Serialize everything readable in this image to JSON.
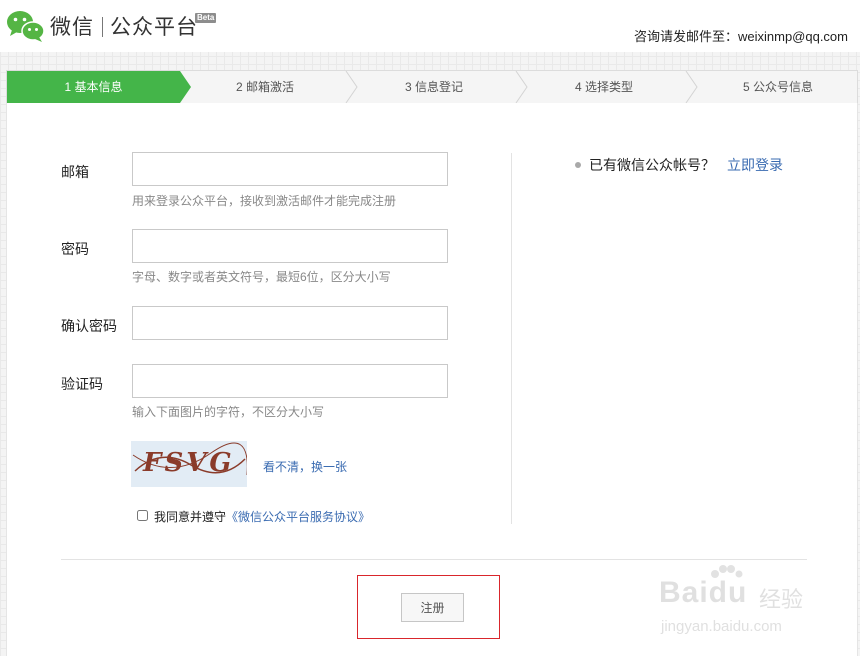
{
  "header": {
    "brand": "微信",
    "product": "公众平台",
    "beta": "Beta",
    "contact_prefix": "咨询请发邮件至：",
    "contact_email": "weixinmp@qq.com"
  },
  "steps": [
    {
      "label": "1 基本信息",
      "active": true
    },
    {
      "label": "2 邮箱激活",
      "active": false
    },
    {
      "label": "3 信息登记",
      "active": false
    },
    {
      "label": "4 选择类型",
      "active": false
    },
    {
      "label": "5 公众号信息",
      "active": false
    }
  ],
  "form": {
    "email": {
      "label": "邮箱",
      "value": "",
      "hint": "用来登录公众平台，接收到激活邮件才能完成注册"
    },
    "password": {
      "label": "密码",
      "value": "",
      "hint": "字母、数字或者英文符号，最短6位，区分大小写"
    },
    "confirm": {
      "label": "确认密码",
      "value": ""
    },
    "captcha": {
      "label": "验证码",
      "value": "",
      "hint": "输入下面图片的字符，不区分大小写",
      "image_text": "FSVG",
      "refresh": "看不清，换一张"
    },
    "agreement": {
      "checked": false,
      "prefix": "我同意并遵守",
      "link": "《微信公众平台服务协议》"
    },
    "submit_label": "注册"
  },
  "sidebar": {
    "question": "已有微信公众帐号？",
    "login_link": "立即登录"
  },
  "watermark": {
    "brand": "Baidu",
    "brand_cn": "经验",
    "url": "jingyan.baidu.com"
  },
  "colors": {
    "accent_green": "#44b549",
    "link_blue": "#3a6bb1",
    "highlight_red": "#d9262c"
  }
}
